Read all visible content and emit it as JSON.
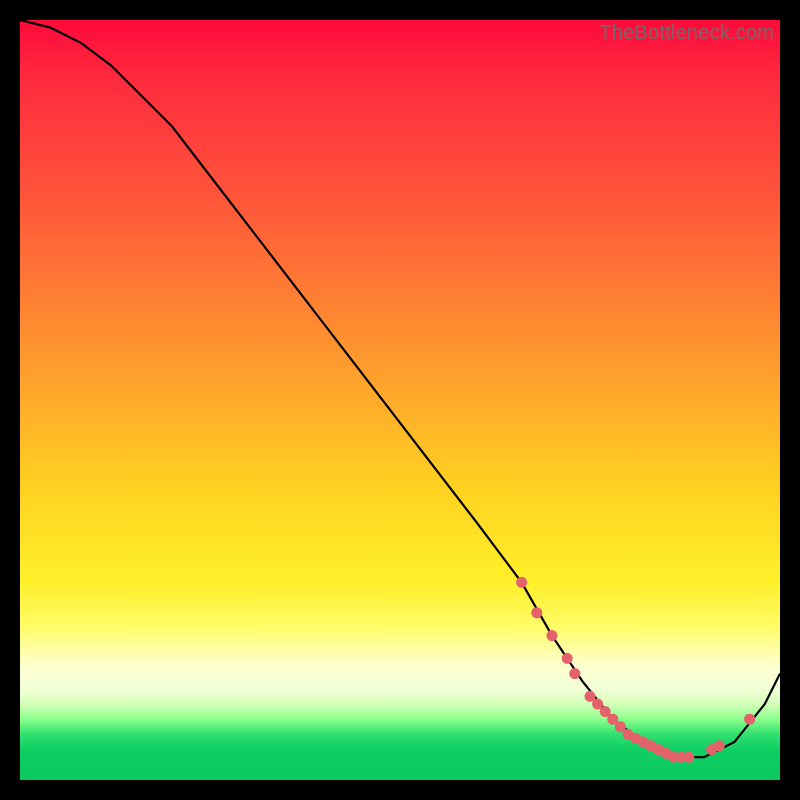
{
  "watermark": "TheBottleneck.com",
  "chart_data": {
    "type": "line",
    "title": "",
    "xlabel": "",
    "ylabel": "",
    "xlim": [
      0,
      100
    ],
    "ylim": [
      0,
      100
    ],
    "series": [
      {
        "name": "curve",
        "x": [
          0,
          4,
          8,
          12,
          20,
          30,
          40,
          50,
          60,
          66,
          70,
          74,
          78,
          82,
          86,
          90,
          94,
          98,
          100
        ],
        "y": [
          100,
          99,
          97,
          94,
          86,
          73,
          60,
          47,
          34,
          26,
          19,
          13,
          8,
          5,
          3,
          3,
          5,
          10,
          14
        ]
      }
    ],
    "points": {
      "name": "markers",
      "x": [
        66,
        68,
        70,
        72,
        73,
        75,
        76,
        77,
        78,
        79,
        80,
        81,
        82,
        83,
        84,
        85,
        86,
        87,
        88,
        91,
        92,
        96
      ],
      "y": [
        26,
        22,
        19,
        16,
        14,
        11,
        10,
        9,
        8,
        7,
        6,
        5.5,
        5,
        4.5,
        4,
        3.5,
        3,
        3,
        3,
        4,
        4.5,
        8
      ]
    },
    "colors": {
      "curve": "#000000",
      "points": "#e4636b"
    }
  }
}
